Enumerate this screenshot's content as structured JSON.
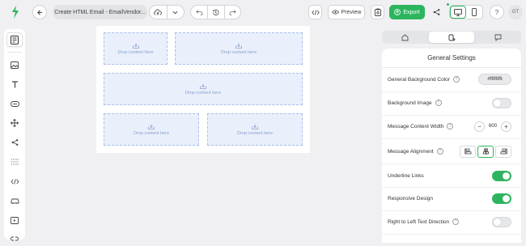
{
  "app": {
    "doc_title": "Create HTML Email - EmailVendor...",
    "preview_label": "Preview",
    "export_label": "Export",
    "avatar_initials": "GT"
  },
  "canvas": {
    "drop_label": "Drop content here"
  },
  "panel": {
    "title": "General Settings",
    "settings": [
      {
        "label": "General Background Color",
        "control": "color",
        "value": "#f6f6f6"
      },
      {
        "label": "Background Image",
        "control": "toggle",
        "value": false
      },
      {
        "label": "Message Content Width",
        "control": "stepper",
        "value": "600"
      },
      {
        "label": "Message Alignment",
        "control": "align",
        "value": "center"
      },
      {
        "label": "Underline Links",
        "control": "toggle",
        "value": true
      },
      {
        "label": "Responsive Design",
        "control": "toggle",
        "value": true
      },
      {
        "label": "Right to Left Text Direction",
        "control": "toggle",
        "value": false
      }
    ]
  },
  "colors": {
    "accent": "#2cb55e",
    "drop_bg": "#e9f0fc",
    "drop_border": "#a9c0ea"
  }
}
